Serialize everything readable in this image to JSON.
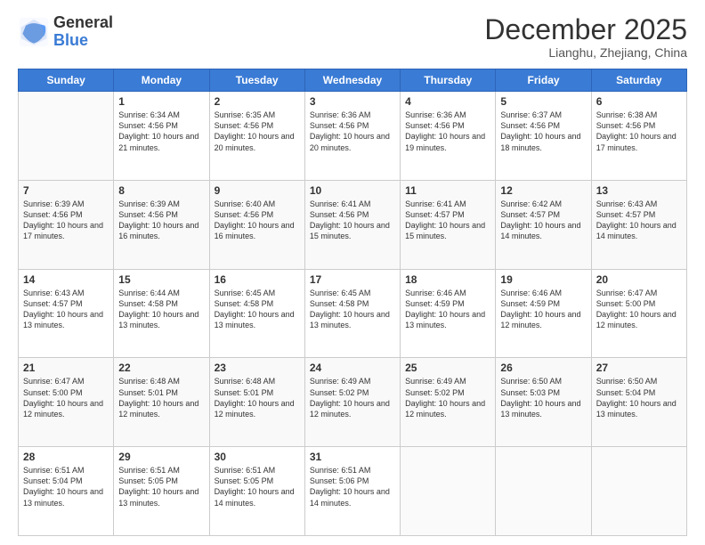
{
  "header": {
    "logo_line1": "General",
    "logo_line2": "Blue",
    "month": "December 2025",
    "location": "Lianghu, Zhejiang, China"
  },
  "weekdays": [
    "Sunday",
    "Monday",
    "Tuesday",
    "Wednesday",
    "Thursday",
    "Friday",
    "Saturday"
  ],
  "weeks": [
    [
      {
        "day": "",
        "info": ""
      },
      {
        "day": "1",
        "info": "Sunrise: 6:34 AM\nSunset: 4:56 PM\nDaylight: 10 hours and 21 minutes."
      },
      {
        "day": "2",
        "info": "Sunrise: 6:35 AM\nSunset: 4:56 PM\nDaylight: 10 hours and 20 minutes."
      },
      {
        "day": "3",
        "info": "Sunrise: 6:36 AM\nSunset: 4:56 PM\nDaylight: 10 hours and 20 minutes."
      },
      {
        "day": "4",
        "info": "Sunrise: 6:36 AM\nSunset: 4:56 PM\nDaylight: 10 hours and 19 minutes."
      },
      {
        "day": "5",
        "info": "Sunrise: 6:37 AM\nSunset: 4:56 PM\nDaylight: 10 hours and 18 minutes."
      },
      {
        "day": "6",
        "info": "Sunrise: 6:38 AM\nSunset: 4:56 PM\nDaylight: 10 hours and 17 minutes."
      }
    ],
    [
      {
        "day": "7",
        "info": "Sunrise: 6:39 AM\nSunset: 4:56 PM\nDaylight: 10 hours and 17 minutes."
      },
      {
        "day": "8",
        "info": "Sunrise: 6:39 AM\nSunset: 4:56 PM\nDaylight: 10 hours and 16 minutes."
      },
      {
        "day": "9",
        "info": "Sunrise: 6:40 AM\nSunset: 4:56 PM\nDaylight: 10 hours and 16 minutes."
      },
      {
        "day": "10",
        "info": "Sunrise: 6:41 AM\nSunset: 4:56 PM\nDaylight: 10 hours and 15 minutes."
      },
      {
        "day": "11",
        "info": "Sunrise: 6:41 AM\nSunset: 4:57 PM\nDaylight: 10 hours and 15 minutes."
      },
      {
        "day": "12",
        "info": "Sunrise: 6:42 AM\nSunset: 4:57 PM\nDaylight: 10 hours and 14 minutes."
      },
      {
        "day": "13",
        "info": "Sunrise: 6:43 AM\nSunset: 4:57 PM\nDaylight: 10 hours and 14 minutes."
      }
    ],
    [
      {
        "day": "14",
        "info": "Sunrise: 6:43 AM\nSunset: 4:57 PM\nDaylight: 10 hours and 13 minutes."
      },
      {
        "day": "15",
        "info": "Sunrise: 6:44 AM\nSunset: 4:58 PM\nDaylight: 10 hours and 13 minutes."
      },
      {
        "day": "16",
        "info": "Sunrise: 6:45 AM\nSunset: 4:58 PM\nDaylight: 10 hours and 13 minutes."
      },
      {
        "day": "17",
        "info": "Sunrise: 6:45 AM\nSunset: 4:58 PM\nDaylight: 10 hours and 13 minutes."
      },
      {
        "day": "18",
        "info": "Sunrise: 6:46 AM\nSunset: 4:59 PM\nDaylight: 10 hours and 13 minutes."
      },
      {
        "day": "19",
        "info": "Sunrise: 6:46 AM\nSunset: 4:59 PM\nDaylight: 10 hours and 12 minutes."
      },
      {
        "day": "20",
        "info": "Sunrise: 6:47 AM\nSunset: 5:00 PM\nDaylight: 10 hours and 12 minutes."
      }
    ],
    [
      {
        "day": "21",
        "info": "Sunrise: 6:47 AM\nSunset: 5:00 PM\nDaylight: 10 hours and 12 minutes."
      },
      {
        "day": "22",
        "info": "Sunrise: 6:48 AM\nSunset: 5:01 PM\nDaylight: 10 hours and 12 minutes."
      },
      {
        "day": "23",
        "info": "Sunrise: 6:48 AM\nSunset: 5:01 PM\nDaylight: 10 hours and 12 minutes."
      },
      {
        "day": "24",
        "info": "Sunrise: 6:49 AM\nSunset: 5:02 PM\nDaylight: 10 hours and 12 minutes."
      },
      {
        "day": "25",
        "info": "Sunrise: 6:49 AM\nSunset: 5:02 PM\nDaylight: 10 hours and 12 minutes."
      },
      {
        "day": "26",
        "info": "Sunrise: 6:50 AM\nSunset: 5:03 PM\nDaylight: 10 hours and 13 minutes."
      },
      {
        "day": "27",
        "info": "Sunrise: 6:50 AM\nSunset: 5:04 PM\nDaylight: 10 hours and 13 minutes."
      }
    ],
    [
      {
        "day": "28",
        "info": "Sunrise: 6:51 AM\nSunset: 5:04 PM\nDaylight: 10 hours and 13 minutes."
      },
      {
        "day": "29",
        "info": "Sunrise: 6:51 AM\nSunset: 5:05 PM\nDaylight: 10 hours and 13 minutes."
      },
      {
        "day": "30",
        "info": "Sunrise: 6:51 AM\nSunset: 5:05 PM\nDaylight: 10 hours and 14 minutes."
      },
      {
        "day": "31",
        "info": "Sunrise: 6:51 AM\nSunset: 5:06 PM\nDaylight: 10 hours and 14 minutes."
      },
      {
        "day": "",
        "info": ""
      },
      {
        "day": "",
        "info": ""
      },
      {
        "day": "",
        "info": ""
      }
    ]
  ]
}
